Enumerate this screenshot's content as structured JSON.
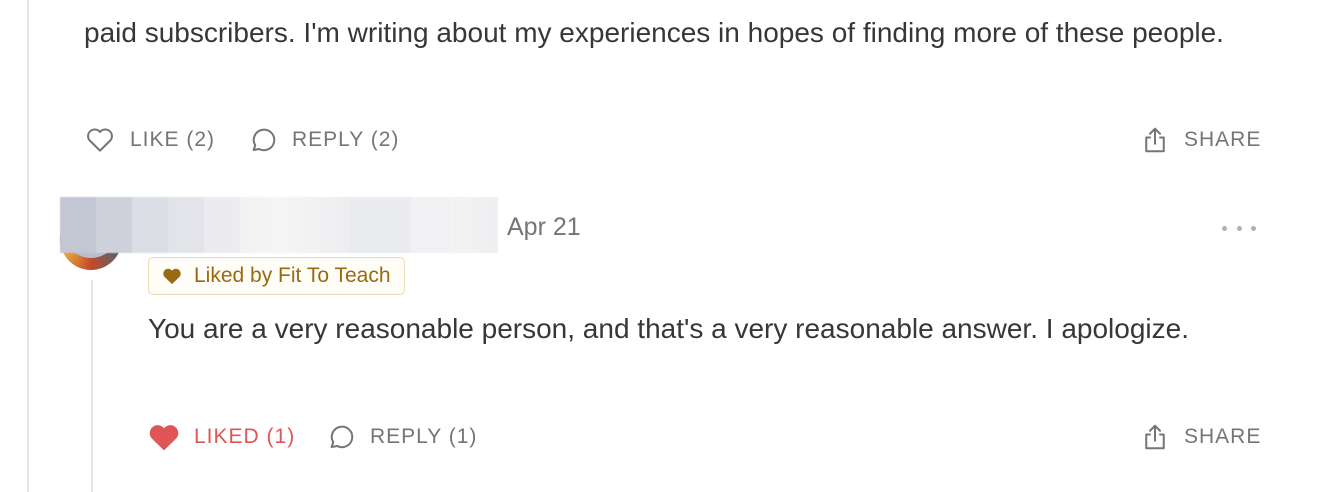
{
  "comment1": {
    "text": "paid subscribers. I'm writing about my experiences in hopes of finding more of these people.",
    "actions": {
      "like_label": "LIKE (2)",
      "reply_label": "REPLY (2)",
      "share_label": "SHARE"
    }
  },
  "comment2": {
    "date": "Apr 21",
    "liked_by": "Liked by Fit To Teach",
    "text": "You are a very reasonable person, and that's a very reasonable answer. I apologize.",
    "actions": {
      "like_label": "LIKED (1)",
      "reply_label": "REPLY (1)",
      "share_label": "SHARE"
    }
  },
  "colors": {
    "text": "#363737",
    "muted": "#757575",
    "liked_red": "#e05555",
    "badge_gold": "#9a6a10"
  },
  "icons": {
    "like": "heart-outline-icon",
    "liked": "heart-filled-icon",
    "reply": "speech-bubble-icon",
    "share": "share-upload-icon",
    "more": "ellipsis-icon",
    "badge": "heart-filled-icon"
  }
}
